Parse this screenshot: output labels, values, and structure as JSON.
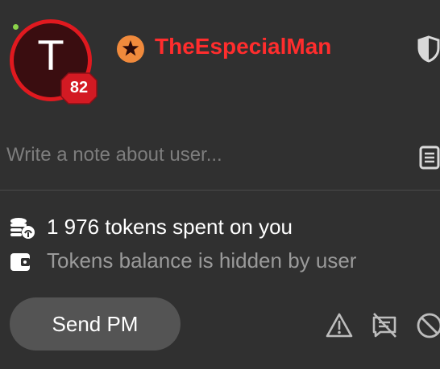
{
  "profile": {
    "avatar_letter": "T",
    "level": "82",
    "username": "TheEspecialMan",
    "status": "online",
    "role_icon": "star-badge-icon"
  },
  "note": {
    "placeholder": "Write a note about user...",
    "value": ""
  },
  "stats": {
    "tokens_spent": "1 976 tokens spent on you",
    "tokens_balance": "Tokens balance is hidden by user"
  },
  "actions": {
    "send_pm_label": "Send PM",
    "icons": [
      "warning-icon",
      "block-chat-icon",
      "ban-icon"
    ]
  },
  "colors": {
    "background": "#303030",
    "username": "#ff2d2d",
    "avatar_ring": "#e0191f",
    "avatar_fill": "#3a0d10",
    "level_badge": "#d31a23",
    "role_badge": "#f08a3c",
    "online_dot": "#8bd34a",
    "button_bg": "#545454",
    "muted_text": "#9a9a9a"
  }
}
